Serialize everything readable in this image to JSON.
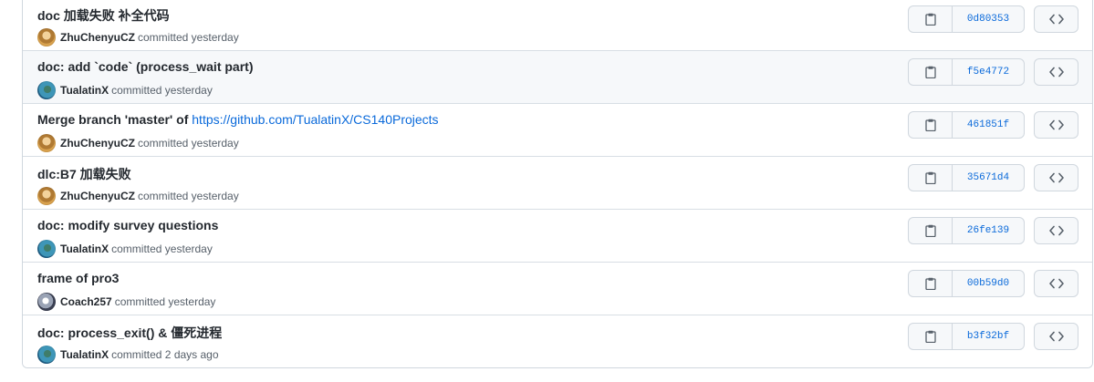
{
  "commits": [
    {
      "message": "doc 加载失败 补全代码",
      "author": "ZhuChenyuCZ",
      "avatar": "zhu",
      "committed": "committed yesterday",
      "sha": "0d80353"
    },
    {
      "message": "doc: add `code` (process_wait part)",
      "author": "TualatinX",
      "avatar": "tua",
      "committed": "committed yesterday",
      "sha": "f5e4772"
    },
    {
      "message": "Merge branch 'master' of",
      "link": "https://github.com/TualatinX/CS140Projects",
      "author": "ZhuChenyuCZ",
      "avatar": "zhu",
      "committed": "committed yesterday",
      "sha": "461851f"
    },
    {
      "message": "dlc:B7 加载失败",
      "author": "ZhuChenyuCZ",
      "avatar": "zhu",
      "committed": "committed yesterday",
      "sha": "35671d4"
    },
    {
      "message": "doc: modify survey questions",
      "author": "TualatinX",
      "avatar": "tua",
      "committed": "committed yesterday",
      "sha": "26fe139"
    },
    {
      "message": "frame of pro3",
      "author": "Coach257",
      "avatar": "coa",
      "committed": "committed yesterday",
      "sha": "00b59d0"
    },
    {
      "message": "doc: process_exit() & 僵死进程",
      "author": "TualatinX",
      "avatar": "tua",
      "committed": "committed 2 days ago",
      "sha": "b3f32bf"
    }
  ],
  "icons": {
    "copy": "clipboard-icon",
    "browse": "code-icon"
  },
  "colors": {
    "link": "#0969da",
    "border": "#d0d7de",
    "button_bg": "#f6f8fa",
    "hover_row": "#f6f8fa"
  }
}
